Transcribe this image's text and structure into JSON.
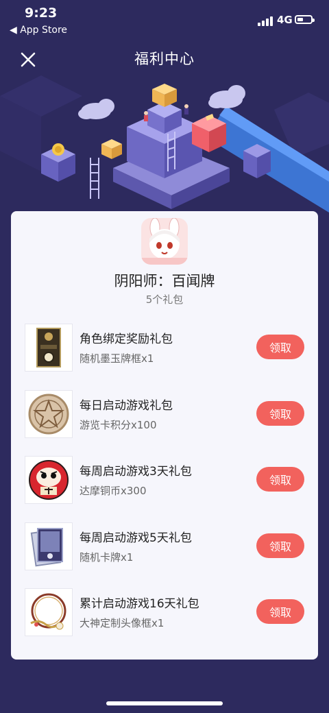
{
  "status_bar": {
    "time": "9:23",
    "back_label": "◀ App Store",
    "network": "4G"
  },
  "nav": {
    "title": "福利中心"
  },
  "app": {
    "name": "阴阳师：百闻牌",
    "gift_count": "5个礼包"
  },
  "gifts": [
    {
      "title": "角色绑定奖励礼包",
      "desc": "随机墨玉牌框x1",
      "button": "领取",
      "icon": "card-frame-icon"
    },
    {
      "title": "每日启动游戏礼包",
      "desc": "游览卡积分x100",
      "button": "领取",
      "icon": "pentagram-coin-icon"
    },
    {
      "title": "每周启动游戏3天礼包",
      "desc": "达摩铜币x300",
      "button": "领取",
      "icon": "daruma-coin-icon"
    },
    {
      "title": "每周启动游戏5天礼包",
      "desc": "随机卡牌x1",
      "button": "领取",
      "icon": "card-stack-icon"
    },
    {
      "title": "累计启动游戏16天礼包",
      "desc": "大神定制头像框x1",
      "button": "领取",
      "icon": "avatar-frame-icon"
    }
  ],
  "colors": {
    "background": "#2d2a5e",
    "card": "#f6f6fc",
    "accent": "#f2625d"
  }
}
